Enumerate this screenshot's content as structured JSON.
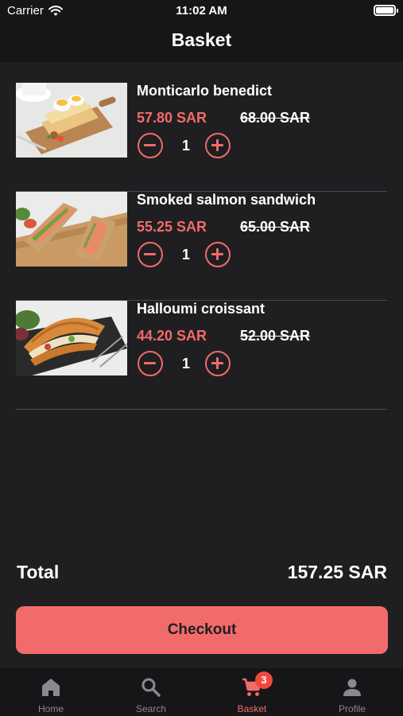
{
  "status_bar": {
    "carrier": "Carrier",
    "time": "11:02 AM"
  },
  "header": {
    "title": "Basket"
  },
  "items": [
    {
      "name": "Monticarlo benedict",
      "price": "57.80 SAR",
      "old_price": "68.00 SAR",
      "quantity": "1",
      "image": "monticarlo-benedict-photo"
    },
    {
      "name": "Smoked salmon sandwich",
      "price": "55.25 SAR",
      "old_price": "65.00 SAR",
      "quantity": "1",
      "image": "smoked-salmon-sandwich-photo"
    },
    {
      "name": "Halloumi croissant",
      "price": "44.20 SAR",
      "old_price": "52.00 SAR",
      "quantity": "1",
      "image": "halloumi-croissant-photo"
    }
  ],
  "summary": {
    "total_label": "Total",
    "total_value": "157.25 SAR"
  },
  "checkout_label": "Checkout",
  "tabs": [
    {
      "label": "Home",
      "icon": "home-icon",
      "active": false
    },
    {
      "label": "Search",
      "icon": "search-icon",
      "active": false
    },
    {
      "label": "Basket",
      "icon": "cart-icon",
      "active": true,
      "badge": "3"
    },
    {
      "label": "Profile",
      "icon": "person-icon",
      "active": false
    }
  ],
  "colors": {
    "accent": "#f26b6b",
    "background": "#1f1f21",
    "bar": "#161618",
    "badge": "#f2473f",
    "inactive_tab": "#8a8a8e"
  }
}
